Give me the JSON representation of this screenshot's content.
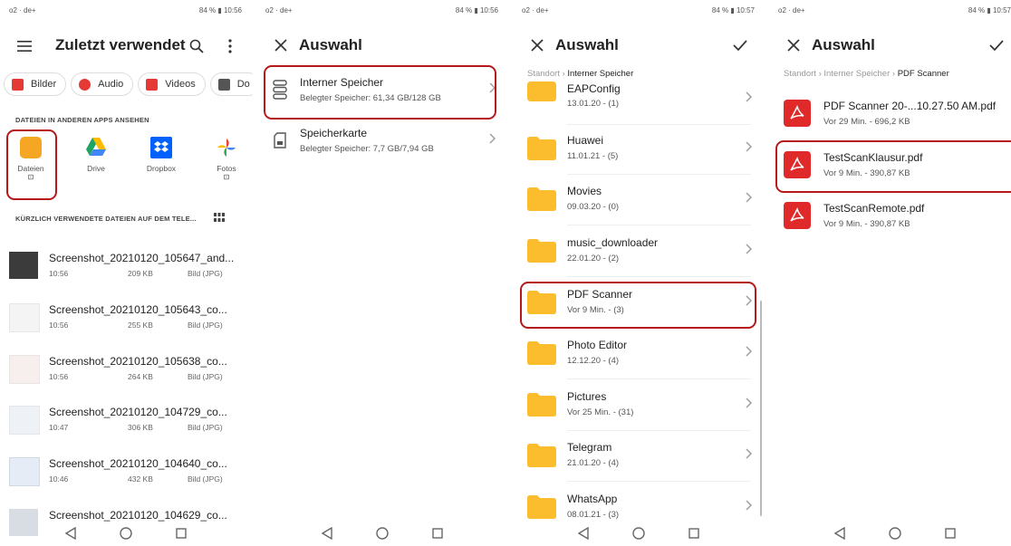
{
  "status": {
    "carrier": "o2 · de+",
    "battery": "84 %",
    "times": [
      "10:56",
      "10:56",
      "10:57",
      "10:57"
    ]
  },
  "screen1": {
    "title": "Zuletzt verwendet",
    "chips": [
      {
        "label": "Bilder",
        "color": "#e53935"
      },
      {
        "label": "Audio",
        "color": "#e53935"
      },
      {
        "label": "Videos",
        "color": "#e53935"
      },
      {
        "label": "Do",
        "color": "#555555"
      }
    ],
    "apps_heading": "DATEIEN IN ANDEREN APPS ANSEHEN",
    "apps": [
      {
        "label": "Dateien",
        "sub": "⊡",
        "color": "#f5a623"
      },
      {
        "label": "Drive",
        "sub": "",
        "color": "#1fa463"
      },
      {
        "label": "Dropbox",
        "sub": "",
        "color": "#0061fe"
      },
      {
        "label": "Fotos",
        "sub": "⊡",
        "color": "#ea4335"
      }
    ],
    "recent_heading": "KÜRZLICH VERWENDETE DATEIEN AUF DEM TELE...",
    "files": [
      {
        "name": "Screenshot_20210120_105647_and...",
        "time": "10:56",
        "size": "209 KB",
        "type": "Bild (JPG)"
      },
      {
        "name": "Screenshot_20210120_105643_co...",
        "time": "10:56",
        "size": "255 KB",
        "type": "Bild (JPG)"
      },
      {
        "name": "Screenshot_20210120_105638_co...",
        "time": "10:56",
        "size": "264 KB",
        "type": "Bild (JPG)"
      },
      {
        "name": "Screenshot_20210120_104729_co...",
        "time": "10:47",
        "size": "306 KB",
        "type": "Bild (JPG)"
      },
      {
        "name": "Screenshot_20210120_104640_co...",
        "time": "10:46",
        "size": "432 KB",
        "type": "Bild (JPG)"
      },
      {
        "name": "Screenshot_20210120_104629_co...",
        "time": "",
        "size": "",
        "type": ""
      }
    ]
  },
  "screen2": {
    "title": "Auswahl",
    "storages": [
      {
        "name": "Interner Speicher",
        "detail": "Belegter Speicher: 61,34 GB/128 GB"
      },
      {
        "name": "Speicherkarte",
        "detail": "Belegter Speicher: 7,7 GB/7,94 GB"
      }
    ]
  },
  "screen3": {
    "title": "Auswahl",
    "crumb_root": "Standort",
    "crumb_current": "Interner Speicher",
    "folders": [
      {
        "name": "EAPConfig",
        "detail": "13.01.20 - (1)"
      },
      {
        "name": "Huawei",
        "detail": "11.01.21 - (5)"
      },
      {
        "name": "Movies",
        "detail": "09.03.20 - (0)"
      },
      {
        "name": "music_downloader",
        "detail": "22.01.20 - (2)"
      },
      {
        "name": "PDF Scanner",
        "detail": "Vor 9 Min. - (3)"
      },
      {
        "name": "Photo Editor",
        "detail": "12.12.20 - (4)"
      },
      {
        "name": "Pictures",
        "detail": "Vor 25 Min. - (31)"
      },
      {
        "name": "Telegram",
        "detail": "21.01.20 - (4)"
      },
      {
        "name": "WhatsApp",
        "detail": "08.01.21 - (3)"
      }
    ]
  },
  "screen4": {
    "title": "Auswahl",
    "crumb_root": "Standort",
    "crumb_mid": "Interner Speicher",
    "crumb_current": "PDF Scanner",
    "files": [
      {
        "name": "PDF Scanner 20-...10.27.50 AM.pdf",
        "detail": "Vor 29 Min. - 696,2 KB"
      },
      {
        "name": "TestScanKlausur.pdf",
        "detail": "Vor 9 Min. - 390,87 KB"
      },
      {
        "name": "TestScanRemote.pdf",
        "detail": "Vor 9 Min. - 390,87 KB"
      }
    ]
  },
  "colors": {
    "highlight": "#b5191c",
    "folder": "#fbbd2e",
    "pdf": "#e02a2a"
  }
}
